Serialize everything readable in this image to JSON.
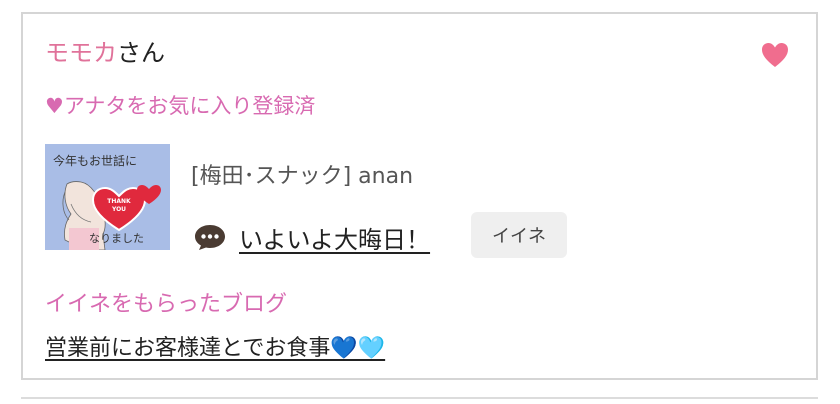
{
  "header": {
    "name": "モモカ",
    "honorific": "さん"
  },
  "favorite_status": "♥アナタをお気に入り登録済",
  "post": {
    "thumbnail_text_top": "今年もお世話に",
    "thumbnail_text_bottom": "なりました",
    "thumbnail_heart_text": "THANK YOU",
    "shop_line": "[梅田･スナック]  anan",
    "title": "いよいよ大晦日！",
    "like_button": "イイネ"
  },
  "liked_blog": {
    "heading": "イイネをもらったブログ",
    "link": "営業前にお客様達とでお食事💙🩵"
  },
  "colors": {
    "accent_pink": "#e0729a",
    "label_magenta": "#d86ab1",
    "heart_icon": "#f06d8e",
    "like_button_bg": "#efefef"
  }
}
